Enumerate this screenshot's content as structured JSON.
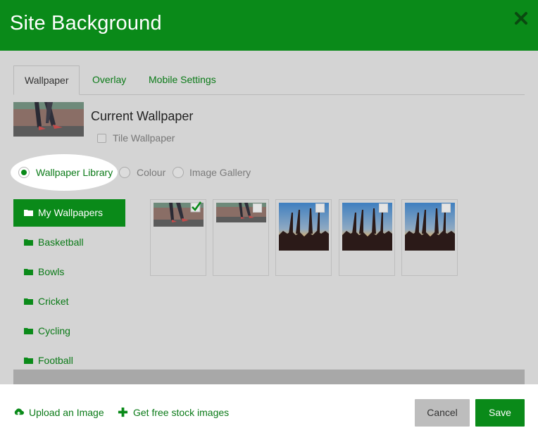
{
  "dialog": {
    "title": "Site Background",
    "close_icon": "close-icon"
  },
  "tabs": [
    {
      "label": "Wallpaper",
      "active": true
    },
    {
      "label": "Overlay",
      "active": false
    },
    {
      "label": "Mobile Settings",
      "active": false
    }
  ],
  "current": {
    "title": "Current Wallpaper",
    "tile_label": "Tile Wallpaper",
    "tile_checked": false
  },
  "source": {
    "options": [
      "Wallpaper Library",
      "Colour",
      "Image Gallery"
    ],
    "selected": "Wallpaper Library"
  },
  "categories": [
    {
      "label": "My Wallpapers",
      "active": true
    },
    {
      "label": "Basketball",
      "active": false
    },
    {
      "label": "Bowls",
      "active": false
    },
    {
      "label": "Cricket",
      "active": false
    },
    {
      "label": "Cycling",
      "active": false
    },
    {
      "label": "Football",
      "active": false
    }
  ],
  "wallpapers": [
    {
      "image": "legs-photo",
      "selected": true
    },
    {
      "image": "legs-photo-wide",
      "selected": false
    },
    {
      "image": "sunset-hands",
      "selected": false
    },
    {
      "image": "sunset-hands",
      "selected": false
    },
    {
      "image": "sunset-hands",
      "selected": false
    }
  ],
  "footer": {
    "upload_label": "Upload an Image",
    "upload_icon": "cloud-upload-icon",
    "stock_label": "Get free stock images",
    "stock_icon": "plus-icon",
    "cancel_label": "Cancel",
    "save_label": "Save"
  },
  "colors": {
    "brand_green": "#0a8a19",
    "link_green": "#0a7a17"
  }
}
